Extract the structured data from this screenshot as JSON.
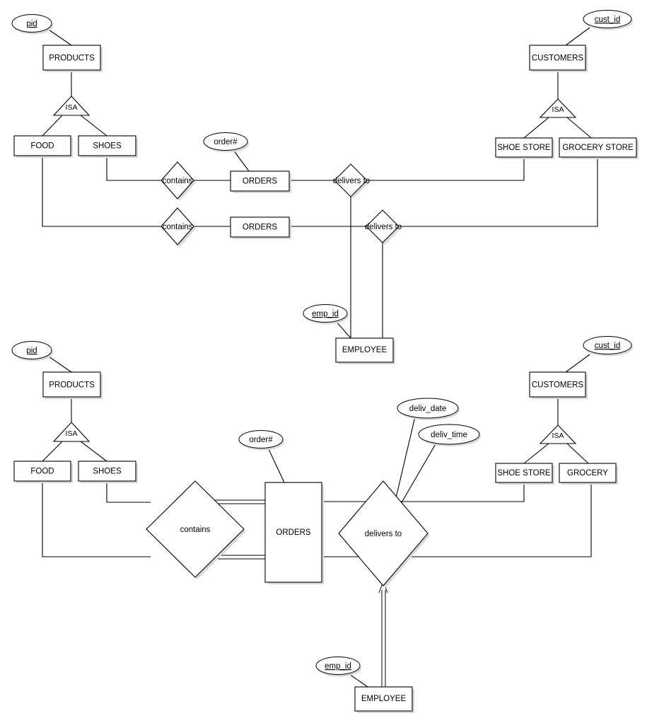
{
  "diagram": {
    "title": "ER Diagram - Products, Orders, Customers, Employee",
    "type": "entity-relationship-diagram",
    "colors": {
      "stroke": "#000000",
      "fill": "#ffffff",
      "shadow": "#d9d9d9",
      "background": "#ffffff"
    }
  },
  "top_diagram": {
    "entities": {
      "products": "PRODUCTS",
      "food": "FOOD",
      "shoes": "SHOES",
      "orders_upper": "ORDERS",
      "orders_lower": "ORDERS",
      "customers": "CUSTOMERS",
      "shoe_store": "SHOE STORE",
      "grocery_store": "GROCERY STORE",
      "employee": "EMPLOYEE"
    },
    "attributes": {
      "pid": "pid",
      "order_num": "order#",
      "cust_id": "cust_id",
      "emp_id": "emp_id"
    },
    "relationships": {
      "contains_upper": "contains",
      "contains_lower": "contains",
      "delivers_to_upper": "delivers to",
      "delivers_to_lower": "delivers to"
    },
    "isa": {
      "products_isa": "ISA",
      "customers_isa": "ISA"
    }
  },
  "bottom_diagram": {
    "entities": {
      "products": "PRODUCTS",
      "food": "FOOD",
      "shoes": "SHOES",
      "orders": "ORDERS",
      "customers": "CUSTOMERS",
      "shoe_store": "SHOE STORE",
      "grocery": "GROCERY",
      "employee": "EMPLOYEE"
    },
    "attributes": {
      "pid": "pid",
      "order_num": "order#",
      "cust_id": "cust_id",
      "emp_id": "emp_id",
      "deliv_date": "deliv_date",
      "deliv_time": "deliv_time"
    },
    "relationships": {
      "contains": "contains",
      "delivers_to": "delivers to"
    },
    "isa": {
      "products_isa": "ISA",
      "customers_isa": "ISA"
    }
  }
}
